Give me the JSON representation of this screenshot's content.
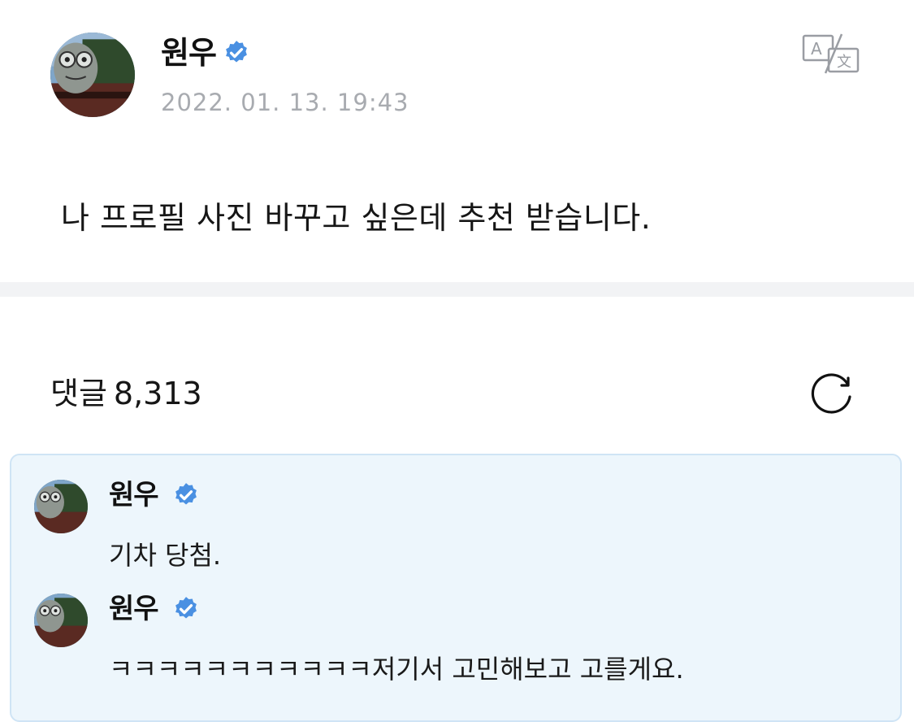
{
  "post": {
    "author": "원우",
    "date": "2022. 01. 13. 19:43",
    "body": "나 프로필 사진 바꾸고 싶은데 추천 받습니다."
  },
  "comments": {
    "label": "댓글",
    "count": "8,313",
    "items": [
      {
        "author": "원우",
        "text": "기차 당첨."
      },
      {
        "author": "원우",
        "text": "ㅋㅋㅋㅋㅋㅋㅋㅋㅋㅋㅋ저기서 고민해보고 고를게요."
      }
    ]
  },
  "icons": {
    "verified": "verified-check-icon",
    "translate": "translate-icon",
    "refresh": "refresh-icon"
  },
  "colors": {
    "verified_blue": "#4a90e2",
    "date_gray": "#a8abb0",
    "highlight_bg": "#edf6fc",
    "highlight_border": "#cfe4f5"
  }
}
